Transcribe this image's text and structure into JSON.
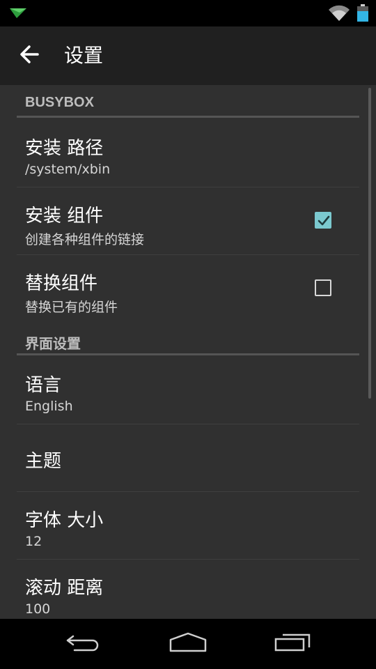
{
  "header": {
    "title": "设置"
  },
  "sections": {
    "busybox": {
      "title": "BUSYBOX",
      "install_path": {
        "title": "安装 路径",
        "summary": "/system/xbin"
      },
      "install_applets": {
        "title": "安装 组件",
        "summary": "创建各种组件的链接",
        "checked": true
      },
      "replace_applets": {
        "title": "替换组件",
        "summary": "替换已有的组件",
        "checked": false
      }
    },
    "interface": {
      "title": "界面设置",
      "language": {
        "title": "语言",
        "summary": "English"
      },
      "theme": {
        "title": "主题"
      },
      "font_size": {
        "title": "字体 大小",
        "summary": "12"
      },
      "scroll_distance": {
        "title": "滚动 距离",
        "summary": "100"
      }
    }
  },
  "colors": {
    "accent": "#7bc9cf",
    "background": "#303030",
    "action_bar": "#202020"
  },
  "icons": {
    "status_left": "app-notification-icon",
    "wifi": "wifi-icon",
    "battery": "battery-icon",
    "back": "arrow-left-icon",
    "nav_back": "nav-back-icon",
    "nav_home": "nav-home-icon",
    "nav_recents": "nav-recents-icon"
  }
}
